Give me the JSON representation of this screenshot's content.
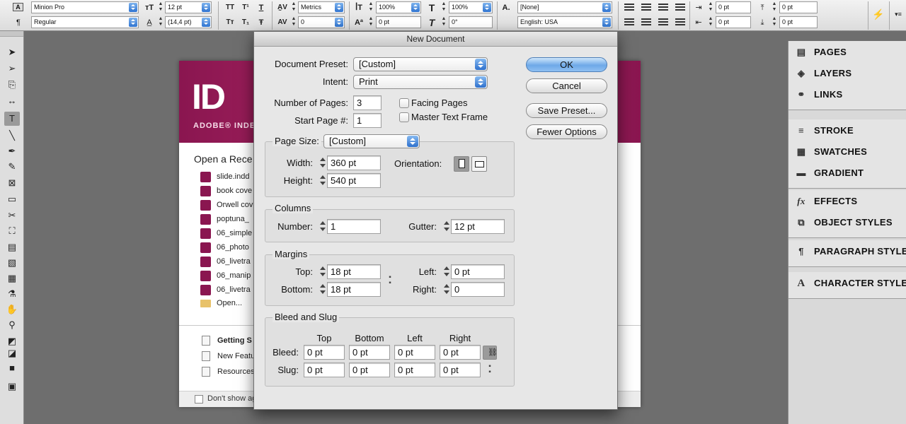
{
  "controlbar": {
    "font_family": "Minion Pro",
    "font_style": "Regular",
    "font_size": "12 pt",
    "leading": "(14,4 pt)",
    "kerning": "Metrics",
    "tracking": "0",
    "vertical_scale": "100%",
    "baseline_shift": "0 pt",
    "horizontal_scale": "100%",
    "skew": "0°",
    "char_style": "[None]",
    "language": "English: USA",
    "left_indent": "0 pt",
    "right_indent": "0 pt",
    "space_before": "0 pt",
    "space_after": "0 pt",
    "icons": {
      "caps": "TT",
      "superscript": "T¹",
      "underline": "T",
      "small_caps": "Tт",
      "subscript": "T₁",
      "strikethrough": "Ŧ",
      "char_a": "A",
      "para_mark": "¶",
      "lightning": "⚡",
      "menu": "▾≡"
    }
  },
  "tools": [
    {
      "name": "selection-tool",
      "glyph": "➤"
    },
    {
      "name": "direct-selection-tool",
      "glyph": "➢"
    },
    {
      "name": "page-tool",
      "glyph": "⎘"
    },
    {
      "name": "gap-tool",
      "glyph": "↔"
    },
    {
      "name": "type-tool",
      "glyph": "T"
    },
    {
      "name": "line-tool",
      "glyph": "╲"
    },
    {
      "name": "pen-tool",
      "glyph": "✒"
    },
    {
      "name": "pencil-tool",
      "glyph": "✎"
    },
    {
      "name": "rectangle-frame-tool",
      "glyph": "⊠"
    },
    {
      "name": "rectangle-tool",
      "glyph": "▭"
    },
    {
      "name": "scissors-tool",
      "glyph": "✂"
    },
    {
      "name": "free-transform-tool",
      "glyph": "⛶"
    },
    {
      "name": "gradient-tool",
      "glyph": "▤"
    },
    {
      "name": "gradient-feather-tool",
      "glyph": "▧"
    },
    {
      "name": "note-tool",
      "glyph": "▦"
    },
    {
      "name": "eyedropper-tool",
      "glyph": "⚗"
    },
    {
      "name": "hand-tool",
      "glyph": "✋"
    },
    {
      "name": "zoom-tool",
      "glyph": "⚲"
    },
    {
      "name": "fill-stroke-swatch",
      "glyph": "◩"
    },
    {
      "name": "default-colors",
      "glyph": "◪"
    },
    {
      "name": "apply-color",
      "glyph": "■"
    },
    {
      "name": "view-mode",
      "glyph": "▣"
    }
  ],
  "welcome": {
    "logo": "ID",
    "brand": "ADOBE® INDE",
    "open_recent": "Open a Rece",
    "recent_files": [
      "slide.indd",
      "book cove",
      "Orwell cov",
      "poptuna_",
      "06_simple",
      "06_photo",
      "06_livetra",
      "06_manip",
      "06_livetra"
    ],
    "open_label": "Open...",
    "links": [
      "Getting S",
      "New Featu",
      "Resources"
    ],
    "dont_show": "Don't show again"
  },
  "panels": {
    "groups": [
      [
        "PAGES",
        "LAYERS",
        "LINKS"
      ],
      [
        "STROKE",
        "SWATCHES",
        "GRADIENT"
      ],
      [
        "EFFECTS",
        "OBJECT STYLES"
      ],
      [
        "PARAGRAPH STYLES"
      ],
      [
        "CHARACTER STYLES"
      ]
    ],
    "icons": {
      "PAGES": "▤",
      "LAYERS": "◈",
      "LINKS": "⚭",
      "STROKE": "≡",
      "SWATCHES": "▦",
      "GRADIENT": "▬",
      "EFFECTS": "fx",
      "OBJECT STYLES": "⧉",
      "PARAGRAPH STYLES": "¶",
      "CHARACTER STYLES": "A"
    }
  },
  "dialog": {
    "title": "New Document",
    "document_preset_label": "Document Preset:",
    "document_preset_value": "[Custom]",
    "intent_label": "Intent:",
    "intent_value": "Print",
    "num_pages_label": "Number of Pages:",
    "num_pages_value": "3",
    "start_page_label": "Start Page #:",
    "start_page_value": "1",
    "facing_pages_label": "Facing Pages",
    "master_text_frame_label": "Master Text Frame",
    "page_size": {
      "label": "Page Size:",
      "value": "[Custom]",
      "width_label": "Width:",
      "width_value": "360 pt",
      "height_label": "Height:",
      "height_value": "540 pt",
      "orientation_label": "Orientation:"
    },
    "columns": {
      "title": "Columns",
      "number_label": "Number:",
      "number_value": "1",
      "gutter_label": "Gutter:",
      "gutter_value": "12 pt"
    },
    "margins": {
      "title": "Margins",
      "top_label": "Top:",
      "top_value": "18 pt",
      "bottom_label": "Bottom:",
      "bottom_value": "18 pt",
      "left_label": "Left:",
      "left_value": "0 pt",
      "right_label": "Right:",
      "right_value": "0"
    },
    "bleed_slug": {
      "title": "Bleed and Slug",
      "headers": [
        "Top",
        "Bottom",
        "Left",
        "Right"
      ],
      "bleed_label": "Bleed:",
      "bleed_values": [
        "0 pt",
        "0 pt",
        "0 pt",
        "0 pt"
      ],
      "slug_label": "Slug:",
      "slug_values": [
        "0 pt",
        "0 pt",
        "0 pt",
        "0 pt"
      ]
    },
    "buttons": {
      "ok": "OK",
      "cancel": "Cancel",
      "save_preset": "Save Preset...",
      "fewer_options": "Fewer Options"
    }
  }
}
